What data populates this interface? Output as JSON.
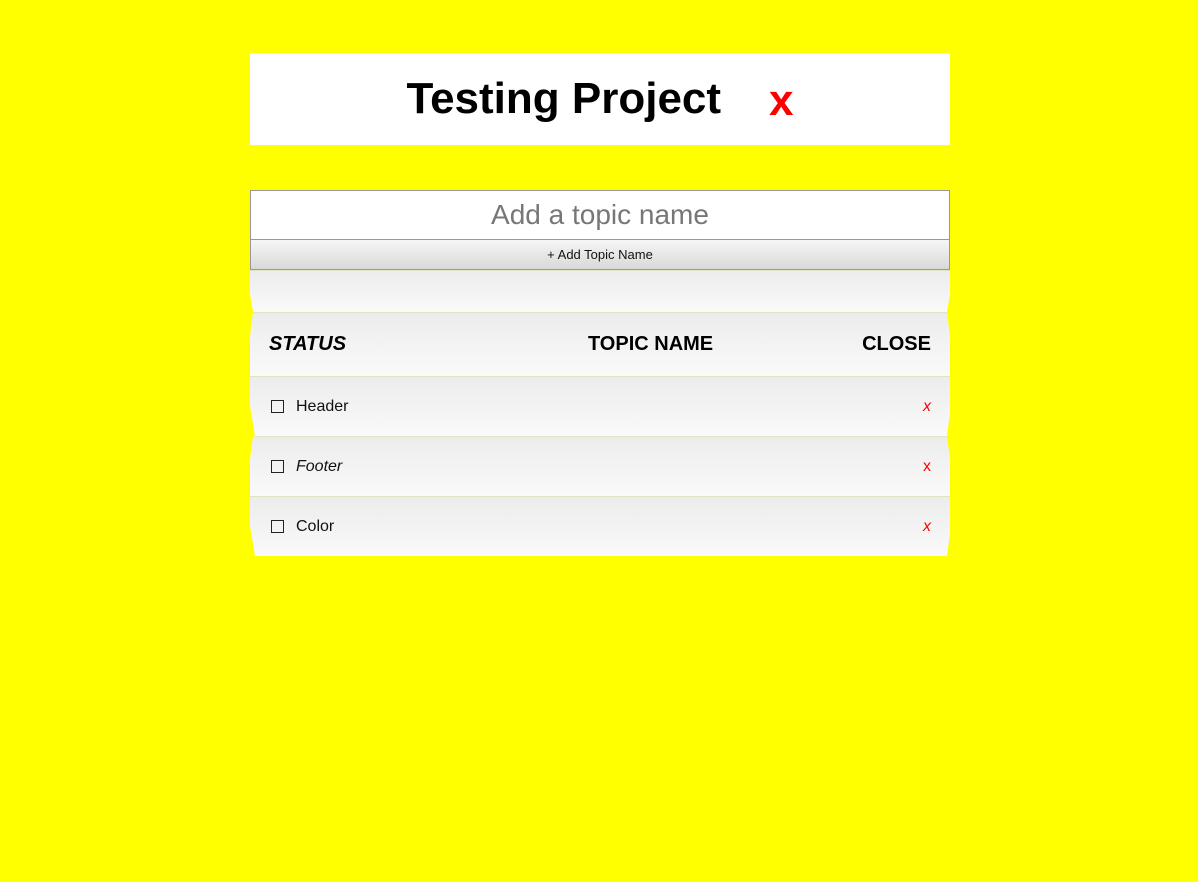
{
  "project": {
    "title": "Testing Project",
    "close_label": "x"
  },
  "add_topic": {
    "placeholder": "Add a topic name",
    "button_label": "+ Add Topic Name"
  },
  "table": {
    "headers": {
      "status": "STATUS",
      "topic": "TOPIC NAME",
      "close": "CLOSE"
    },
    "rows": [
      {
        "label": "Header",
        "close": "x",
        "checked": false
      },
      {
        "label": "Footer",
        "close": "x",
        "checked": false
      },
      {
        "label": "Color",
        "close": "x",
        "checked": false
      }
    ]
  },
  "colors": {
    "background": "#ffff00",
    "close": "#ff0000"
  }
}
